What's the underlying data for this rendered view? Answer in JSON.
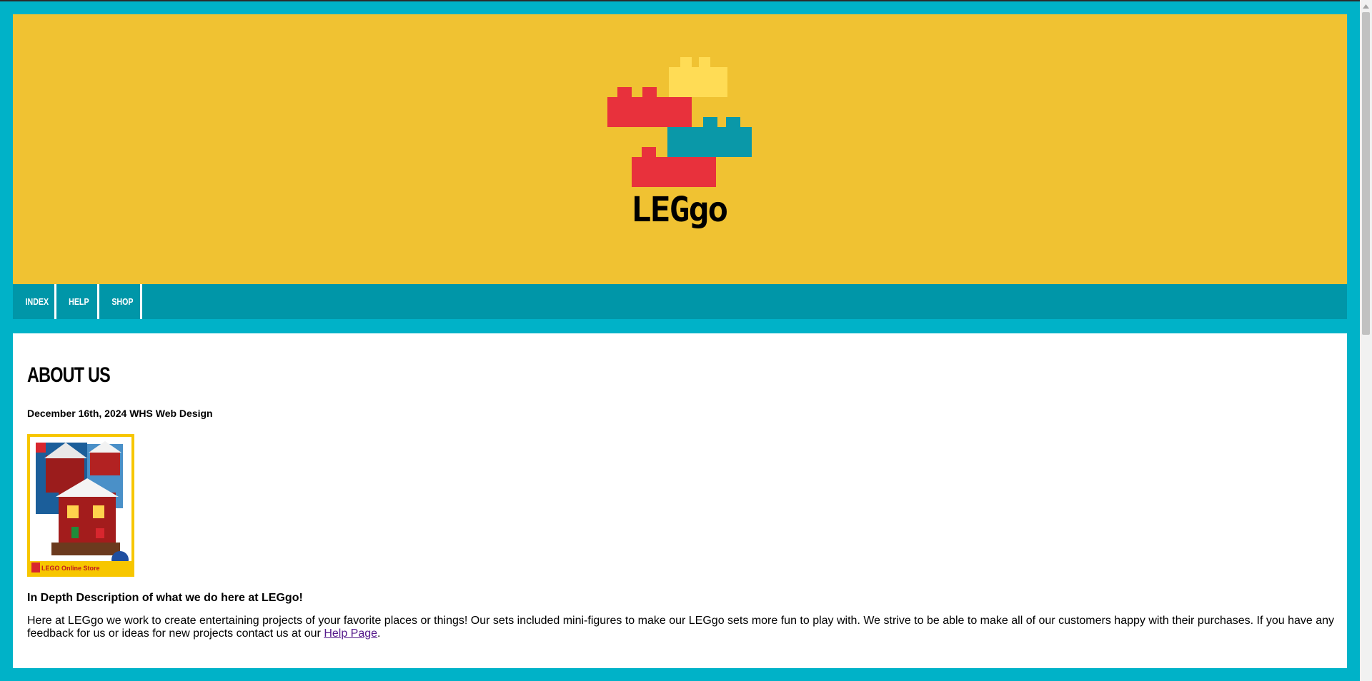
{
  "site": {
    "logo_text": "LEGgo",
    "colors": {
      "page_bg": "#00b2c8",
      "banner_bg": "#f0c232",
      "nav_bg": "#0096a8",
      "brick_red": "#e8313c",
      "brick_yellow": "#ffdc55",
      "brick_teal": "#0a98a8"
    }
  },
  "nav": {
    "items": [
      {
        "label": "INDEX"
      },
      {
        "label": "HELP"
      },
      {
        "label": "SHOP"
      }
    ]
  },
  "main": {
    "title": "ABOUT US",
    "dateline": "December 16th, 2024 WHS Web Design",
    "image": {
      "caption": "LEGO Online Store",
      "icon": "lego-set-box-image"
    },
    "subheading": "In Depth Description of what we do here at LEGgo!",
    "paragraph_text": "Here at LEGgo we work to create entertaining projects of your favorite places or things! Our sets included mini-figures to make our LEGgo sets more fun to play with. We strive to be able to make all of our customers happy with their purchases. If you have any feedback for us or ideas for new projects contact us at our ",
    "help_link": "Help Page",
    "paragraph_end": "."
  },
  "scrollbar": {
    "up_icon": "chevron-up-icon"
  }
}
